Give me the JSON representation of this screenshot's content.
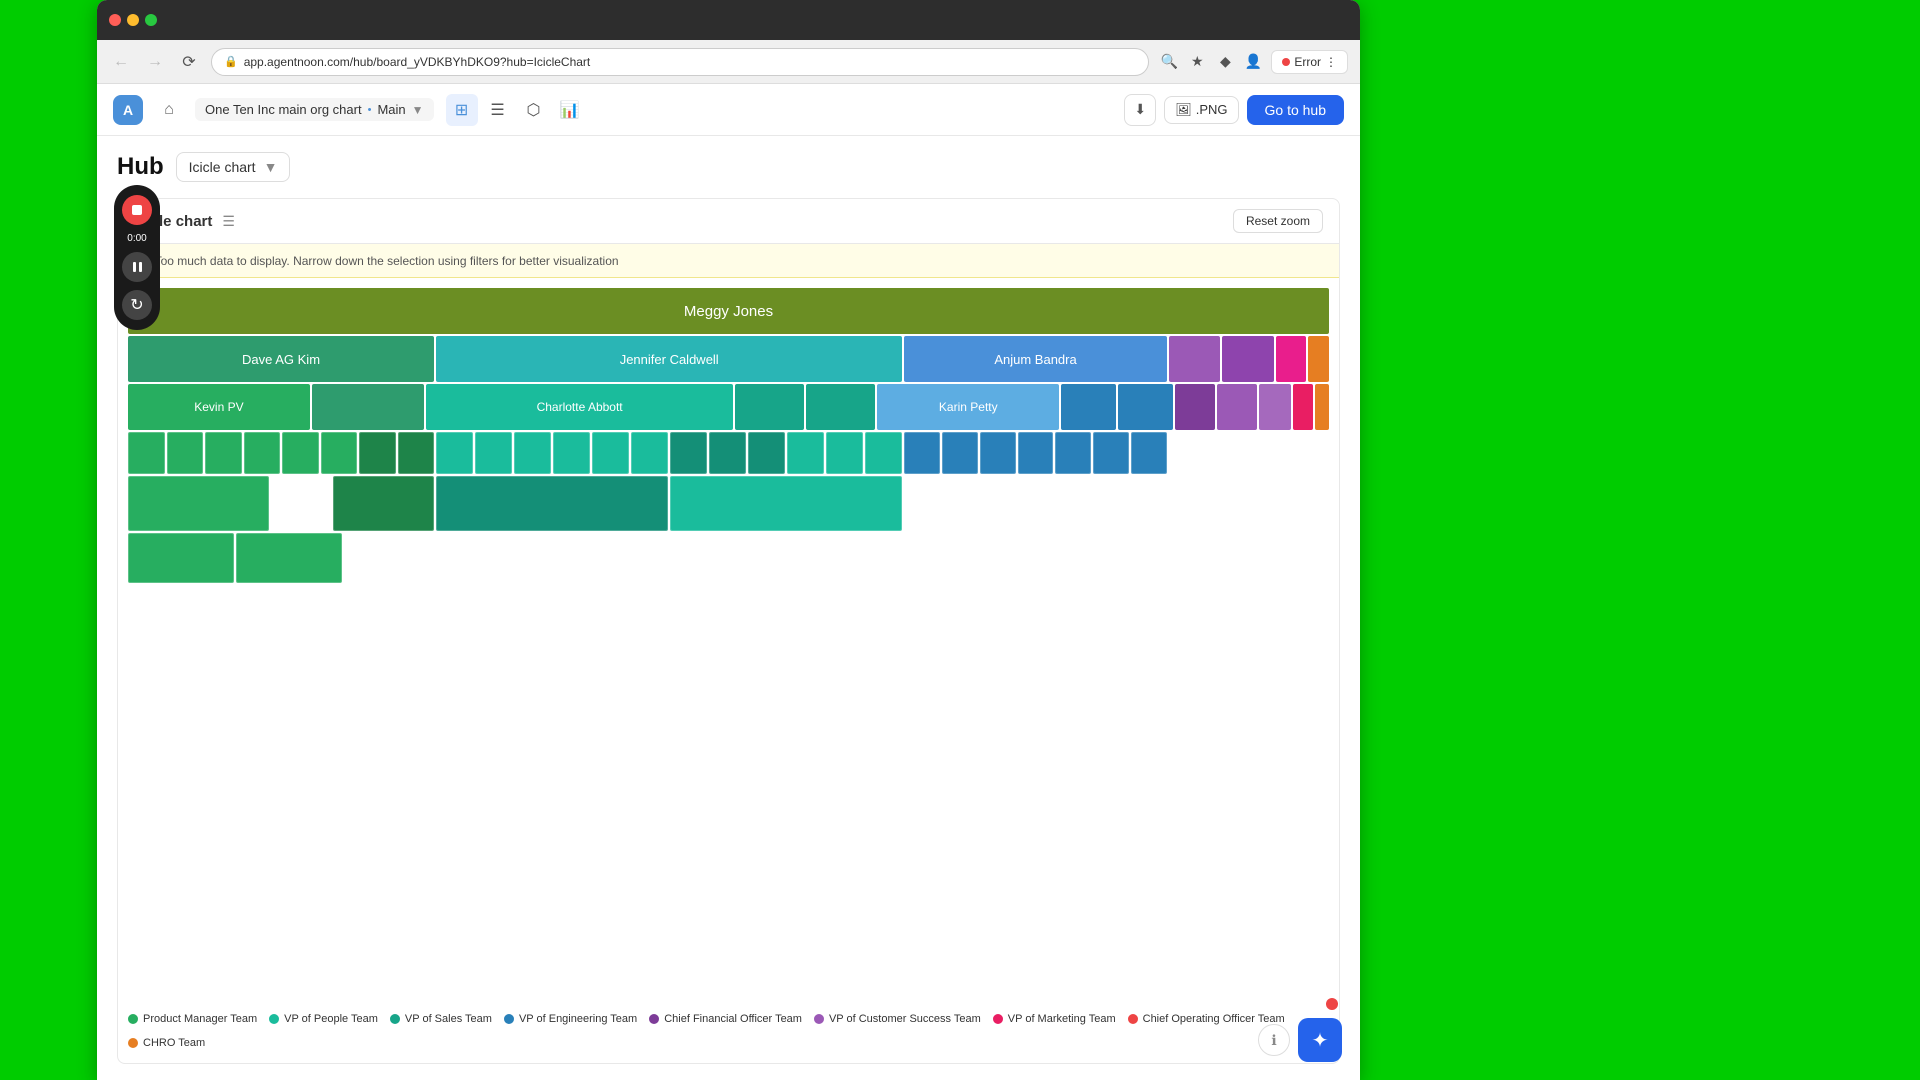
{
  "browser": {
    "url": "app.agentnoon.com/hub/board_yVDKBYhDKO9?hub=IcicleChart",
    "error_label": "Error"
  },
  "nav": {
    "logo_label": "A",
    "breadcrumb_org": "One Ten Inc main org chart",
    "breadcrumb_separator": "•",
    "breadcrumb_main": "Main",
    "toolbar_icons": [
      "grid-icon",
      "list-icon",
      "share-icon",
      "chart-icon"
    ],
    "png_label": ".PNG",
    "go_to_hub_label": "Go to hub"
  },
  "hub": {
    "title": "Hub",
    "chart_type": "Icicle chart",
    "chart_panel_title": "Icicle chart",
    "reset_zoom_label": "Reset zoom",
    "warning_text": "Too much data to display. Narrow down the selection using filters for better visualization"
  },
  "chart": {
    "root_label": "Meggy Jones",
    "nodes": {
      "dave": "Dave AG Kim",
      "jennifer": "Jennifer Caldwell",
      "anjum": "Anjum Bandra",
      "kevin": "Kevin PV",
      "charlotte": "Charlotte Abbott",
      "karin": "Karin Petty"
    }
  },
  "legend": [
    {
      "label": "Product Manager Team",
      "color": "#27ae60"
    },
    {
      "label": "VP of People Team",
      "color": "#1abc9c"
    },
    {
      "label": "VP of Sales Team",
      "color": "#17a589"
    },
    {
      "label": "VP of Engineering Team",
      "color": "#2980b9"
    },
    {
      "label": "Chief Financial Officer Team",
      "color": "#7d3c98"
    },
    {
      "label": "VP of Customer Success Team",
      "color": "#9b59b6"
    },
    {
      "label": "VP of Marketing Team",
      "color": "#e91e63"
    },
    {
      "label": "Chief Operating Officer Team",
      "color": "#e44"
    },
    {
      "label": "CHRO Team",
      "color": "#e67e22"
    }
  ],
  "recording": {
    "time": "0:00"
  }
}
